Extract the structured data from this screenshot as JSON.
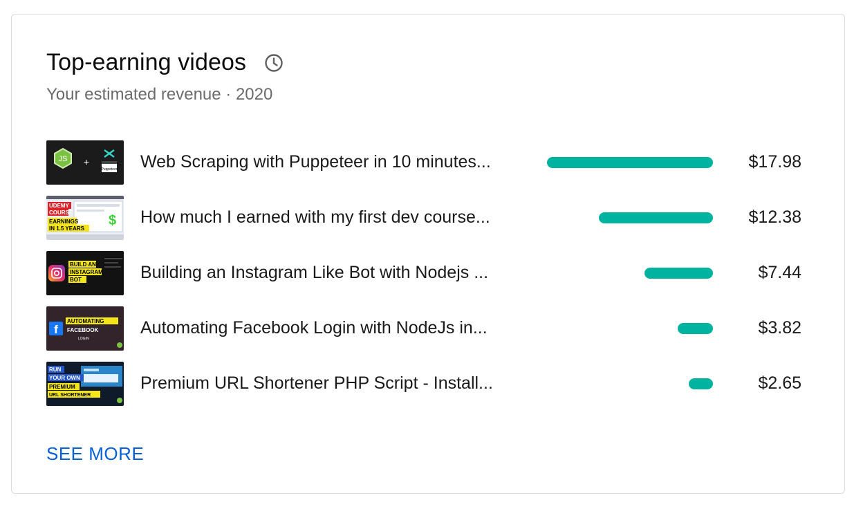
{
  "card": {
    "title": "Top-earning videos",
    "info_icon": "clock-icon",
    "subtitle": "Your estimated revenue · 2020",
    "see_more_label": "SEE MORE"
  },
  "accent_color": "#00b3a1",
  "link_color": "#065fd4",
  "max_revenue": 17.98,
  "videos": [
    {
      "title": "Web Scraping with Puppeteer in 10 minutes...",
      "revenue_label": "$17.98",
      "revenue": 17.98,
      "thumb_text": [
        "Puppeteer"
      ]
    },
    {
      "title": "How much I earned with my first dev course...",
      "revenue_label": "$12.38",
      "revenue": 12.38,
      "thumb_text": [
        "UDEMY",
        "COURSE",
        "EARNINGS",
        "IN 1.5 YEARS"
      ]
    },
    {
      "title": "Building an Instagram Like Bot with Nodejs ...",
      "revenue_label": "$7.44",
      "revenue": 7.44,
      "thumb_text": [
        "BUILD AN",
        "INSTAGRAM",
        "BOT"
      ]
    },
    {
      "title": "Automating Facebook Login with NodeJs in...",
      "revenue_label": "$3.82",
      "revenue": 3.82,
      "thumb_text": [
        "AUTOMATING",
        "FACEBOOK",
        "LOGIN"
      ]
    },
    {
      "title": "Premium URL Shortener PHP Script - Install...",
      "revenue_label": "$2.65",
      "revenue": 2.65,
      "thumb_text": [
        "RUN",
        "YOUR OWN",
        "PREMIUM",
        "URL SHORTENER"
      ]
    }
  ]
}
